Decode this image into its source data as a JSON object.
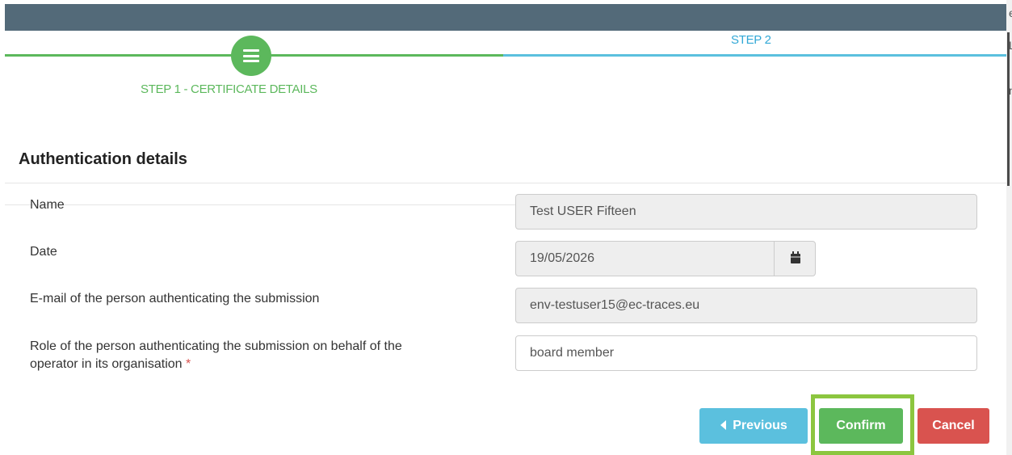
{
  "stepper": {
    "step1_label": "STEP 1 - CERTIFICATE DETAILS",
    "step2_label": "STEP 2",
    "step1_icon": "menu-icon",
    "colors": {
      "completed": "#5cb85c",
      "upcoming": "#5bc0de"
    }
  },
  "section": {
    "title": "Authentication details"
  },
  "form": {
    "name": {
      "label": "Name",
      "value": "Test USER Fifteen"
    },
    "date": {
      "label": "Date",
      "value": "19/05/2026",
      "icon": "calendar-icon"
    },
    "email": {
      "label": "E-mail of the person authenticating the submission",
      "value": "env-testuser15@ec-traces.eu"
    },
    "role": {
      "label_line1": "Role of the person authenticating the submission on behalf of the",
      "label_line2": "operator in its organisation",
      "required_mark": "*",
      "value": "board member"
    }
  },
  "buttons": {
    "previous": "Previous",
    "previous_icon": "caret-left-icon",
    "confirm": "Confirm",
    "cancel": "Cancel"
  },
  "colors": {
    "header": "#536a79",
    "previous": "#5bc0de",
    "confirm": "#5cb85c",
    "cancel": "#d9534f",
    "highlight": "#8cc63f"
  }
}
